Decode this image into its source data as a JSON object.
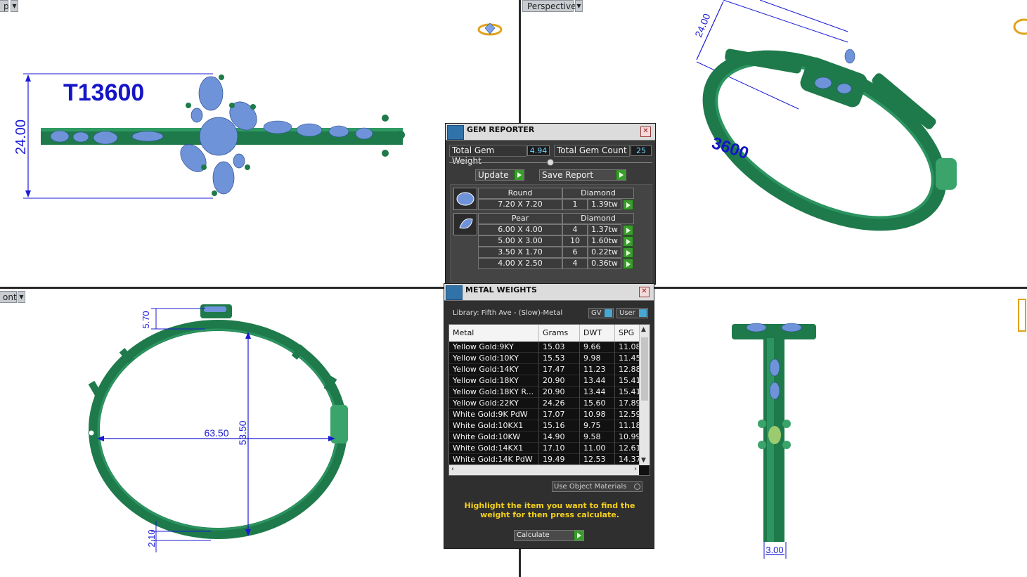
{
  "viewports": {
    "top_left": {
      "label": "p",
      "model_id": "T13600",
      "dim_height": "24.00"
    },
    "top_right": {
      "label": "Perspective",
      "dim_height": "24.00",
      "model_id_partial": "3600"
    },
    "bottom_left": {
      "label": "ont",
      "dim_top": "5.70",
      "dim_width": "63.50",
      "dim_height": "53.50",
      "dim_bottom": "2.10"
    },
    "bottom_right": {
      "dim_width": "3.00"
    }
  },
  "gem_reporter": {
    "title": "GEM REPORTER",
    "total_weight_label": "Total Gem Weight",
    "total_weight_value": "4.94",
    "total_count_label": "Total Gem Count",
    "total_count_value": "25",
    "update_label": "Update",
    "save_label": "Save Report",
    "groups": [
      {
        "shape": "Round",
        "type": "Diamond",
        "rows": [
          {
            "size": "7.20 X 7.20",
            "qty": "1",
            "weight": "1.39tw"
          }
        ]
      },
      {
        "shape": "Pear",
        "type": "Diamond",
        "rows": [
          {
            "size": "6.00 X 4.00",
            "qty": "4",
            "weight": "1.37tw"
          },
          {
            "size": "5.00 X 3.00",
            "qty": "10",
            "weight": "1.60tw"
          },
          {
            "size": "3.50 X 1.70",
            "qty": "6",
            "weight": "0.22tw"
          },
          {
            "size": "4.00 X 2.50",
            "qty": "4",
            "weight": "0.36tw"
          }
        ]
      }
    ]
  },
  "metal_weights": {
    "title": "METAL WEIGHTS",
    "library": "Library: Fifth Ave - (Slow)-Metal",
    "gv_label": "GV",
    "user_label": "User",
    "columns": [
      "Metal",
      "Grams",
      "DWT",
      "SPG"
    ],
    "rows": [
      [
        "Yellow Gold:9KY",
        "15.03",
        "9.66",
        "11.08"
      ],
      [
        "Yellow Gold:10KY",
        "15.53",
        "9.98",
        "11.45"
      ],
      [
        "Yellow Gold:14KY",
        "17.47",
        "11.23",
        "12.88"
      ],
      [
        "Yellow Gold:18KY",
        "20.90",
        "13.44",
        "15.41"
      ],
      [
        "Yellow Gold:18KY R...",
        "20.90",
        "13.44",
        "15.41"
      ],
      [
        "Yellow Gold:22KY",
        "24.26",
        "15.60",
        "17.89"
      ],
      [
        "White Gold:9K PdW",
        "17.07",
        "10.98",
        "12.59"
      ],
      [
        "White Gold:10KX1",
        "15.16",
        "9.75",
        "11.18"
      ],
      [
        "White Gold:10KW",
        "14.90",
        "9.58",
        "10.99"
      ],
      [
        "White Gold:14KX1",
        "17.10",
        "11.00",
        "12.61"
      ],
      [
        "White Gold:14K PdW",
        "19.49",
        "12.53",
        "14.37"
      ]
    ],
    "use_object_materials": "Use Object Materials",
    "hint": "Highlight the item you want to find the weight for then press calculate.",
    "calculate_label": "Calculate"
  },
  "colors": {
    "ring_green": "#1e7a4a",
    "gem_blue": "#6f93d8",
    "dim_blue": "#1a1ad6",
    "panel_bg": "#3a3a3a"
  }
}
